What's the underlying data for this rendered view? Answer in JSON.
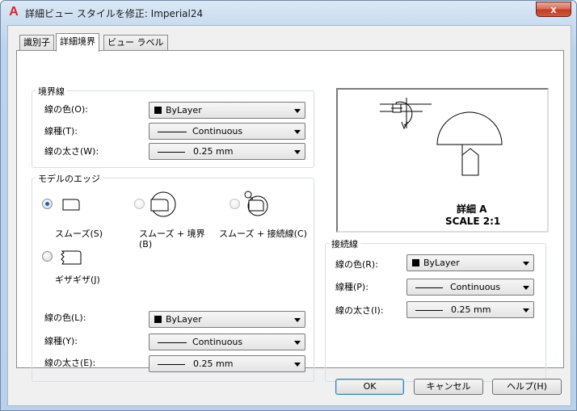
{
  "window": {
    "title": "詳細ビュー スタイルを修正: Imperial24",
    "app_icon": "A",
    "close_glyph": "x"
  },
  "tabs": [
    {
      "label": "識別子"
    },
    {
      "label": "詳細境界"
    },
    {
      "label": "ビュー ラベル"
    }
  ],
  "boundary": {
    "legend": "境界線",
    "color_label": "線の色(O):",
    "color_value": "ByLayer",
    "linetype_label": "線種(T):",
    "linetype_value": "Continuous",
    "weight_label": "線の太さ(W):",
    "weight_value": "0.25 mm"
  },
  "model_edge": {
    "legend": "モデルのエッジ",
    "options": [
      {
        "label": "スムーズ(S)",
        "checked": true
      },
      {
        "label": "スムーズ + 境界 (B)",
        "checked": false
      },
      {
        "label": "スムーズ + 接続線(C)",
        "checked": false
      },
      {
        "label": "ギザギザ(J)",
        "checked": false
      }
    ],
    "opt2_line1": "スムーズ + 境界",
    "opt2_line2": "(B)",
    "color_label": "線の色(L):",
    "color_value": "ByLayer",
    "linetype_label": "線種(Y):",
    "linetype_value": "Continuous",
    "weight_label": "線の太さ(E):",
    "weight_value": "0.25 mm"
  },
  "preview": {
    "title": "詳細 A",
    "scale": "SCALE 2:1"
  },
  "connection": {
    "legend": "接続線",
    "color_label": "線の色(R):",
    "color_value": "ByLayer",
    "linetype_label": "線種(P):",
    "linetype_value": "Continuous",
    "weight_label": "線の太さ(I):",
    "weight_value": "0.25 mm"
  },
  "buttons": {
    "ok": "OK",
    "cancel": "キャンセル",
    "help": "ヘルプ(H)"
  }
}
